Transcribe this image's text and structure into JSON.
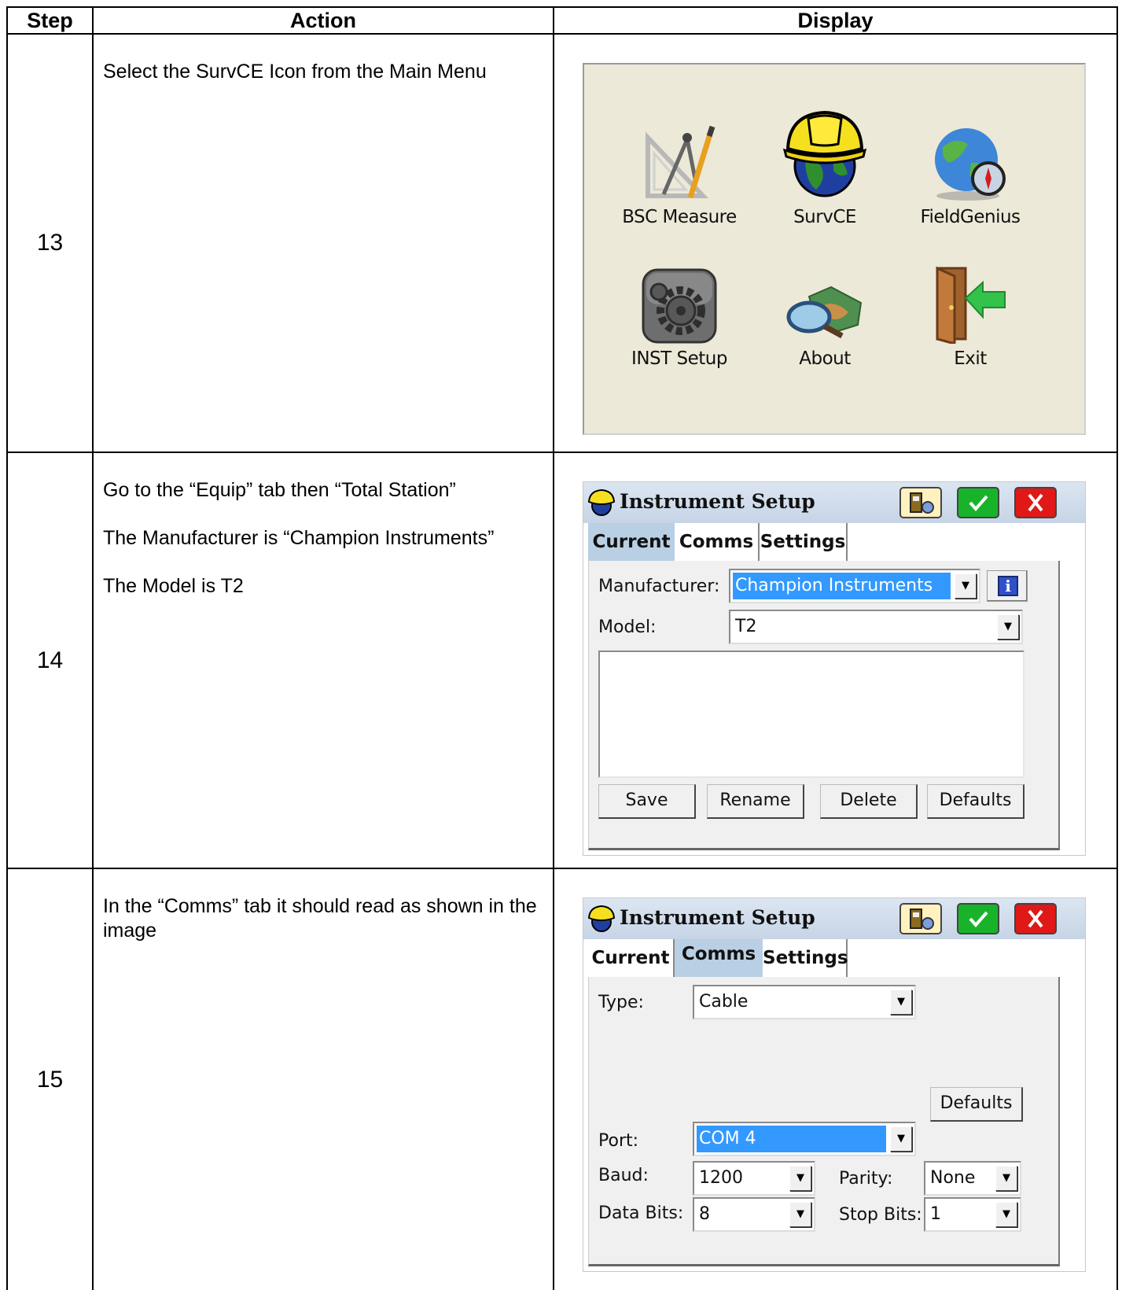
{
  "headers": {
    "step": "Step",
    "action": "Action",
    "display": "Display"
  },
  "rows": [
    {
      "step": "13",
      "action": [
        "Select the SurvCE Icon from the Main Menu"
      ],
      "display": {
        "menu_items": [
          {
            "label": "BSC Measure",
            "icon": "drafting-tools-icon"
          },
          {
            "label": "SurvCE",
            "icon": "hardhat-globe-icon"
          },
          {
            "label": "FieldGenius",
            "icon": "globe-compass-icon"
          },
          {
            "label": "INST Setup",
            "icon": "gears-icon"
          },
          {
            "label": "About",
            "icon": "map-magnifier-icon"
          },
          {
            "label": "Exit",
            "icon": "exit-door-icon"
          }
        ]
      }
    },
    {
      "step": "14",
      "action": [
        "Go to the “Equip” tab then “Total Station”",
        "The Manufacturer is “Champion Instruments”",
        "The Model is T2"
      ],
      "display": {
        "title": "Instrument Setup",
        "tabs": [
          "Current",
          "Comms",
          "Settings"
        ],
        "active_tab": "Current",
        "manufacturer_label": "Manufacturer:",
        "manufacturer_value": "Champion Instruments",
        "model_label": "Model:",
        "model_value": "T2",
        "buttons": [
          "Save",
          "Rename",
          "Delete",
          "Defaults"
        ]
      }
    },
    {
      "step": "15",
      "action": [
        "In the “Comms” tab it should read as shown in the image"
      ],
      "display": {
        "title": "Instrument Setup",
        "tabs": [
          "Current",
          "Comms",
          "Settings"
        ],
        "active_tab": "Comms",
        "type_label": "Type:",
        "type_value": "Cable",
        "defaults_button": "Defaults",
        "port_label": "Port:",
        "port_value": "COM 4",
        "baud_label": "Baud:",
        "baud_value": "1200",
        "parity_label": "Parity:",
        "parity_value": "None",
        "data_bits_label": "Data Bits:",
        "data_bits_value": "8",
        "stop_bits_label": "Stop Bits:",
        "stop_bits_value": "1"
      }
    }
  ],
  "colors": {
    "title_bar": "#c6d4e6",
    "active_tab": "#b9cfe4",
    "selection": "#3399ff",
    "ok_button": "#19b32b",
    "cancel_button": "#e01818",
    "menu_background": "#ece9d8"
  }
}
